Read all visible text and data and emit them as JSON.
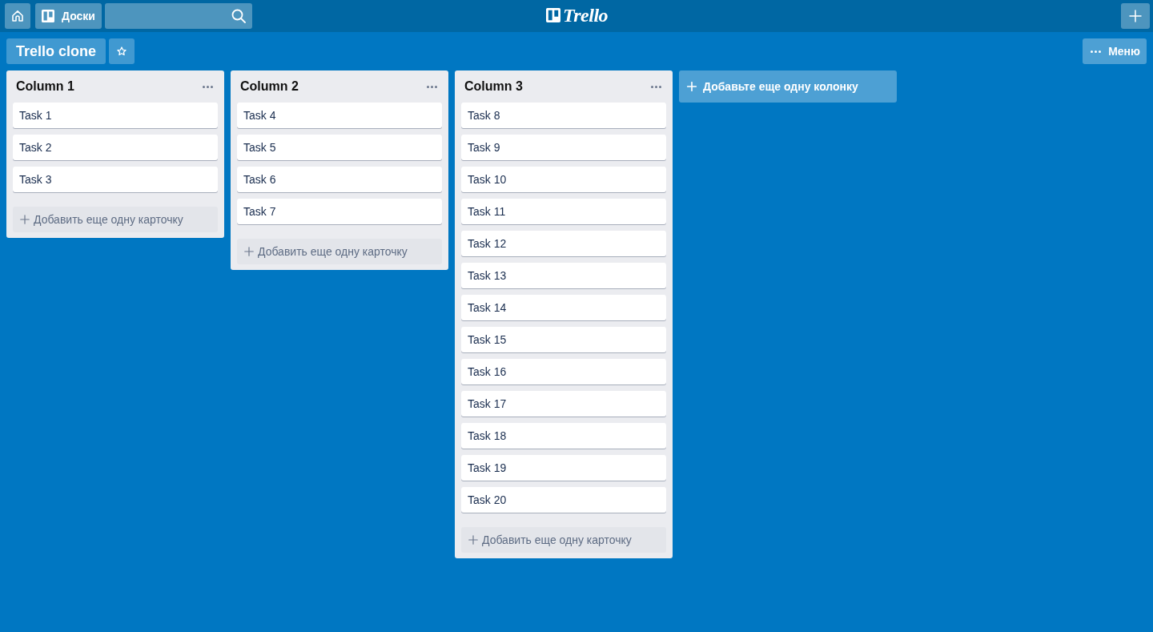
{
  "header": {
    "boards_button": {
      "label": "Доски"
    },
    "logo": {
      "text": "Trello"
    }
  },
  "board": {
    "title": "Trello clone",
    "starred": false,
    "menu_button": {
      "label": "Меню"
    }
  },
  "columns": [
    {
      "title": "Column 1",
      "cards": [
        "Task 1",
        "Task 2",
        "Task 3"
      ],
      "add_card_label": "Добавить еще одну карточку"
    },
    {
      "title": "Column 2",
      "cards": [
        "Task 4",
        "Task 5",
        "Task 6",
        "Task 7"
      ],
      "add_card_label": "Добавить еще одну карточку"
    },
    {
      "title": "Column 3",
      "cards": [
        "Task 8",
        "Task 9",
        "Task 10",
        "Task 11",
        "Task 12",
        "Task 13",
        "Task 14",
        "Task 15",
        "Task 16",
        "Task 17",
        "Task 18",
        "Task 19",
        "Task 20"
      ],
      "add_card_label": "Добавить еще одну карточку"
    }
  ],
  "add_column": {
    "label": "Добавьте еще одну колонку"
  }
}
